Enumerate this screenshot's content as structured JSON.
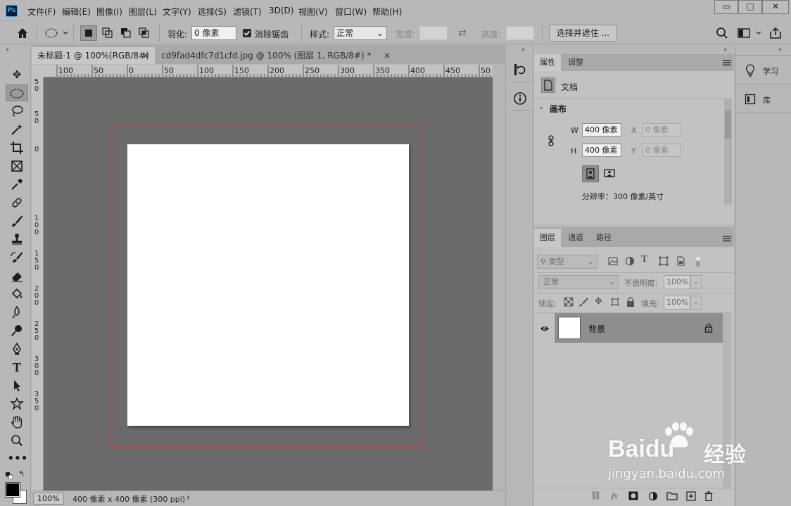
{
  "app": {
    "logo_text": "Ps"
  },
  "menu": [
    "文件(F)",
    "编辑(E)",
    "图像(I)",
    "图层(L)",
    "文字(Y)",
    "选择(S)",
    "滤镜(T)",
    "3D(D)",
    "视图(V)",
    "窗口(W)",
    "帮助(H)"
  ],
  "window_controls": {
    "minimize": "▭",
    "maximize": "□",
    "close": "✕"
  },
  "options": {
    "feather_label": "羽化:",
    "feather_value": "0 像素",
    "antialias_label": "消除锯齿",
    "style_label": "样式:",
    "style_value": "正常",
    "width_label": "宽度:",
    "height_label": "高度:",
    "select_mask_button": "选择并遮住 ..."
  },
  "tabs": [
    {
      "label": "未标题-1 @ 100%(RGB/8#)",
      "close": "×"
    },
    {
      "label": "cd9fad4dfc7d1cfd.jpg @ 100% (图层 1, RGB/8#) *",
      "close": "×"
    }
  ],
  "ruler": {
    "h_ticks": [
      "100",
      "50",
      "0",
      "50",
      "100",
      "150",
      "200",
      "250",
      "300",
      "350",
      "400",
      "450",
      "50"
    ],
    "v_ticks": [
      "5",
      "0",
      "5",
      "0",
      "0",
      "1",
      "0",
      "0",
      "1",
      "5",
      "0",
      "2",
      "0",
      "0",
      "2",
      "5",
      "0",
      "3",
      "0",
      "0",
      "3",
      "5",
      "0"
    ]
  },
  "status": {
    "zoom": "100%",
    "doc_size": "400 像素 x 400 像素 (300 ppi)",
    "arrow": "›"
  },
  "properties": {
    "tab_properties": "属性",
    "tab_adjust": "调整",
    "doc_label": "文档",
    "section_canvas": "画布",
    "w_label": "W",
    "w_value": "400 像素",
    "h_label": "H",
    "h_value": "400 像素",
    "x_label": "X",
    "x_placeholder": "0 像素",
    "y_label": "Y",
    "y_placeholder": "0 像素",
    "resolution": "分辨率：300 像素/英寸"
  },
  "layers": {
    "tab_layers": "图层",
    "tab_channels": "通道",
    "tab_paths": "路径",
    "filter_kind": "类型",
    "blend_mode": "正常",
    "opacity_label": "不透明度:",
    "opacity_value": "100%",
    "lock_label": "锁定:",
    "fill_label": "填充:",
    "fill_value": "100%",
    "layer_name": "背景"
  },
  "right_panels": {
    "learn": "学习",
    "library": "库"
  },
  "watermark": {
    "brand": "Baidu",
    "brand_cn": "经验",
    "url": "jingyan.baidu.com"
  }
}
